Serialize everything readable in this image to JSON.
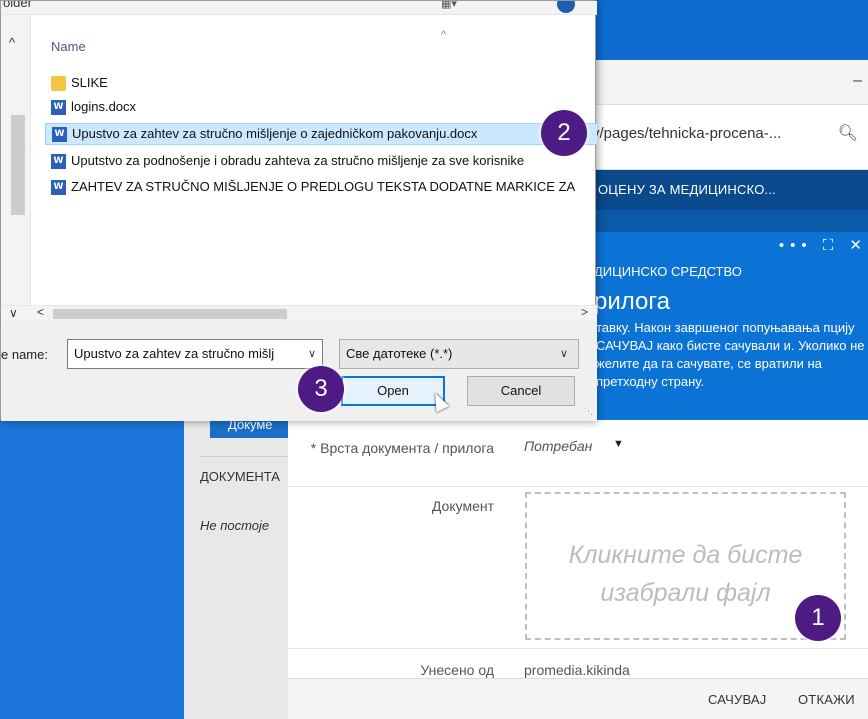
{
  "file_dialog": {
    "title_partial": "older",
    "column_header": "Name",
    "files": [
      {
        "name": "SLIKE",
        "icon": "folder-icon"
      },
      {
        "name": "logins.docx",
        "icon": "word-doc-icon"
      },
      {
        "name": "Upustvo za zahtev za stručno mišljenje o zajedničkom pakovanju.docx",
        "icon": "word-doc-icon",
        "selected": true
      },
      {
        "name": "Uputstvo za podnošenje i obradu zahteva za stručno mišljenje za sve korisnike",
        "icon": "word-doc-icon"
      },
      {
        "name": "ZAHTEV ZA STRUČNO MIŠLJENJE O PREDLOGU TEKSTA DODATNE MARKICE ZA",
        "icon": "word-doc-icon"
      }
    ],
    "file_name_label": "e name:",
    "file_name_value": "Upustvo za zahtev za stručno mišlj",
    "file_type_value": "Све датотеке (*.*)",
    "open_label": "Open",
    "cancel_label": "Cancel"
  },
  "browser": {
    "url_partial": "y/pages/tehnicka-procena-...",
    "minus": "–",
    "zoom_icon": "magnifier-icon"
  },
  "page_header": {
    "title_partial": "ОЦЕНУ ЗА МЕДИЦИНСКО..."
  },
  "panel": {
    "toolbar": "••• ⛶ ✕",
    "subtitle": "ДИЦИНСКО СРЕДСТВО",
    "title": "рилога",
    "description": "тавку. Након завршеног попуњавања пцију САЧУВАЈ како бисте сачували и. Уколико не желите да га сачувате, се вратили на претходну страну."
  },
  "background_list": {
    "button_partial": "Докуме",
    "label_partial": "ДОКУМЕНТА",
    "empty_partial": "Не постоје"
  },
  "form": {
    "doc_type_label": "* Врста документа / прилога",
    "doc_type_value": "Потребан",
    "document_label": "Документ",
    "dropzone_text": "Кликните да бисте изабрали фајл",
    "entered_by_label": "Унесено од",
    "entered_by_value": "promedia.kikinda",
    "save_label": "САЧУВАЈ",
    "cancel_label": "ОТКАЖИ"
  },
  "badges": {
    "one": "1",
    "two": "2",
    "three": "3"
  },
  "colors": {
    "badge": "#4e1a83",
    "panel_blue": "#0b73d6",
    "selected_row": "#cce8ff",
    "open_border": "#0078d7"
  }
}
